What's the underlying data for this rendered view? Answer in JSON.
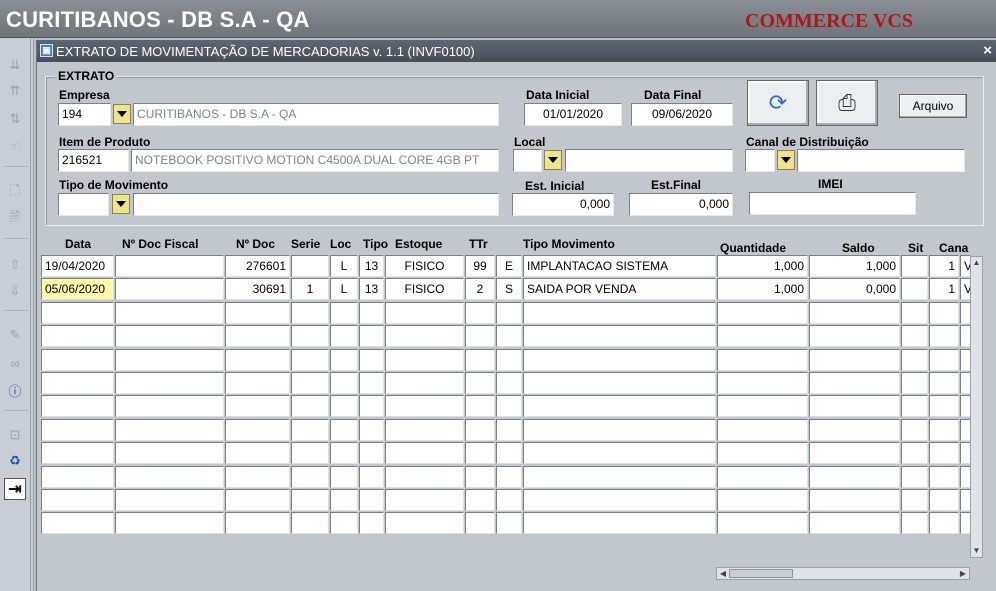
{
  "app": {
    "title": "CURITIBANOS - DB S.A - QA",
    "brand": "COMMERCE VCS"
  },
  "toolbar_icons": [
    "navigate-icon",
    "navigate-icon",
    "navigate-icon",
    "hand-icon",
    "new-record-icon",
    "edit-record-icon",
    "up-arrow-icon",
    "down-arrow-icon",
    "notes-icon",
    "binoculars-icon",
    "help-icon",
    "lock-icon",
    "trash-icon",
    "exit-icon"
  ],
  "window": {
    "title": "EXTRATO DE MOVIMENTAÇÃO DE MERCADORIAS v. 1.1 (INVF0100)",
    "close": "×"
  },
  "form": {
    "group_label": "EXTRATO",
    "empresa": {
      "label": "Empresa",
      "code": "194",
      "name": "CURITIBANOS - DB S.A - QA"
    },
    "data_inicial": {
      "label": "Data Inicial",
      "value": "01/01/2020"
    },
    "data_final": {
      "label": "Data Final",
      "value": "09/06/2020"
    },
    "arquivo_label": "Arquivo",
    "item": {
      "label": "Item de Produto",
      "code": "216521",
      "name": "NOTEBOOK POSITIVO MOTION C4500A DUAL CORE 4GB PT"
    },
    "local": {
      "label": "Local",
      "code": "",
      "name": ""
    },
    "canal": {
      "label": "Canal de Distribuição",
      "code": "",
      "name": ""
    },
    "tipo_mov": {
      "label": "Tipo de Movimento",
      "code": "",
      "name": ""
    },
    "est_inicial": {
      "label": "Est. Inicial",
      "value": "0,000"
    },
    "est_final": {
      "label": "Est.Final",
      "value": "0,000"
    },
    "imei": {
      "label": "IMEI",
      "value": ""
    }
  },
  "grid": {
    "headers": [
      "Data",
      "Nº Doc Fiscal",
      "Nº Doc",
      "Serie",
      "Loc",
      "Tipo",
      "Estoque",
      "TTr",
      "Tipo Movimento",
      "Quantidade",
      "Saldo",
      "Sit",
      "Cana"
    ],
    "rows": [
      [
        "19/04/2020",
        "",
        "276601",
        "",
        "L",
        "13",
        "FISICO",
        "99",
        "E",
        "IMPLANTACAO SISTEMA",
        "1,000",
        "1,000",
        "",
        "1",
        "V"
      ],
      [
        "05/06/2020",
        "",
        "30691",
        "1",
        "L",
        "13",
        "FISICO",
        "2",
        "S",
        "SAIDA POR VENDA",
        "1,000",
        "0,000",
        "",
        "1",
        "V"
      ]
    ]
  }
}
